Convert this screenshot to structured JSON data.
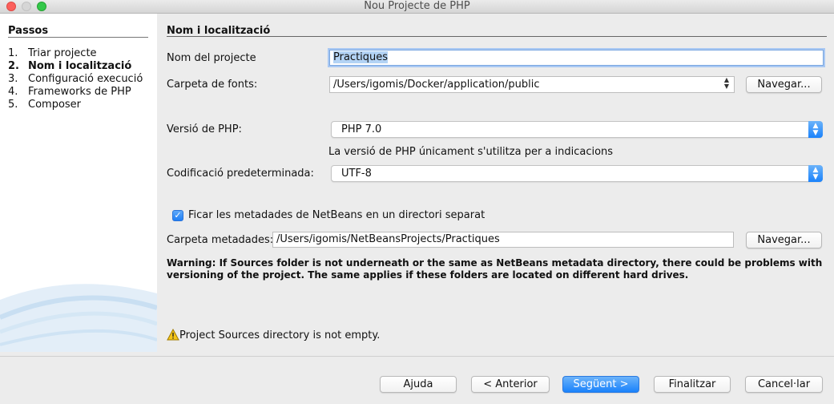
{
  "window": {
    "title": "Nou Projecte de  PHP"
  },
  "steps": {
    "title": "Passos",
    "items": [
      {
        "num": "1.",
        "label": "Triar projecte"
      },
      {
        "num": "2.",
        "label": "Nom i localització"
      },
      {
        "num": "3.",
        "label": "Configuració execució"
      },
      {
        "num": "4.",
        "label": "Frameworks de PHP"
      },
      {
        "num": "5.",
        "label": "Composer"
      }
    ]
  },
  "form": {
    "section_title": "Nom i localització",
    "project_name_label": "Nom del projecte",
    "project_name_selected": "Practiques",
    "project_name_rest": "",
    "sources_label": "Carpeta de fonts:",
    "sources_value": "/Users/igomis/Docker/application/public",
    "browse_label": "Navegar...",
    "php_version_label": "Versió de PHP:",
    "php_version_value": "PHP 7.0",
    "php_version_hint": "La versió de PHP únicament s'utilitza per a indicacions",
    "encoding_label": "Codificació predeterminada:",
    "encoding_value": "UTF-8",
    "metadata_checkbox_label": "Ficar les metadades de NetBeans en un directori separat",
    "metadata_checked": true,
    "metadata_folder_label": "Carpeta metadades:",
    "metadata_folder_value": "/Users/igomis/NetBeansProjects/Practiques",
    "browse2_label": "Navegar...",
    "warning_text": "Warning: If Sources folder is not underneath or the same as NetBeans metadata directory, there could be problems with versioning of the project. The same applies if these folders are located on different hard drives.",
    "sources_warning": "Project Sources directory is not empty."
  },
  "buttons": {
    "help": "Ajuda",
    "back": "< Anterior",
    "next": "Següent >",
    "finish": "Finalitzar",
    "cancel": "Cancel·lar"
  },
  "colors": {
    "accent": "#1a82fb",
    "selection": "#b3d3f5",
    "warning_icon": "#f5c518"
  },
  "icons": {
    "warning": "warning-icon",
    "combo_arrow": "chevron-updown-icon"
  }
}
